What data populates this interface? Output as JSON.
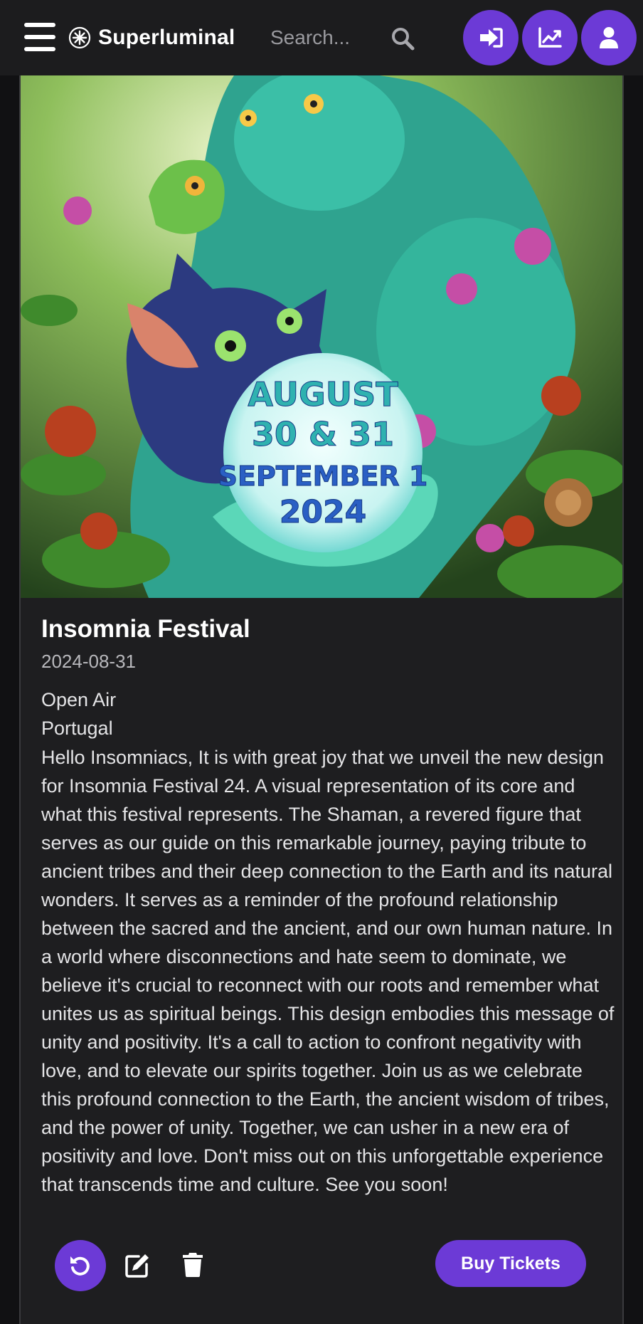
{
  "navbar": {
    "menu_icon": "hamburger-icon",
    "brand": {
      "logo_icon": "starburst-logo-icon",
      "name": "Superluminal"
    },
    "search": {
      "placeholder": "Search...",
      "value": "",
      "icon": "search-icon"
    },
    "actions": [
      {
        "name": "login-button",
        "icon": "sign-in-icon"
      },
      {
        "name": "stats-button",
        "icon": "chart-line-icon"
      },
      {
        "name": "profile-button",
        "icon": "user-icon"
      }
    ]
  },
  "event": {
    "poster": {
      "lines": [
        "AUGUST",
        "30 & 31",
        "SEPTEMBER 1",
        "2024"
      ]
    },
    "title": "Insomnia Festival",
    "date": "2024-08-31",
    "venue_type": "Open Air",
    "country": "Portugal",
    "description": "Hello Insomniacs, It is with great joy that we unveil the new design for Insomnia Festival 24. A visual representation of its core and what this festival represents. The Shaman, a revered figure that serves as our guide on this remarkable journey, paying tribute to ancient tribes and their deep connection to the Earth and its natural wonders. It serves as a reminder of the profound relationship between the sacred and the ancient, and our own human nature. In a world where disconnections and hate seem to dominate, we believe it's crucial to reconnect with our roots and remember what unites us as spiritual beings. This design embodies this message of unity and positivity. It's a call to action to confront negativity with love, and to elevate our spirits together. Join us as we celebrate this profound connection to the Earth, the ancient wisdom of tribes, and the power of unity. Together, we can usher in a new era of positivity and love. Don't miss out on this unforgettable experience that transcends time and culture. See you soon!"
  },
  "actions": {
    "refresh_icon": "undo-icon",
    "edit_icon": "edit-icon",
    "delete_icon": "trash-icon",
    "buy_label": "Buy Tickets"
  },
  "colors": {
    "accent": "#6c3ad6",
    "navbar_bg": "#1c1c1e",
    "card_bg": "#1e1e20",
    "page_bg": "#111113"
  }
}
